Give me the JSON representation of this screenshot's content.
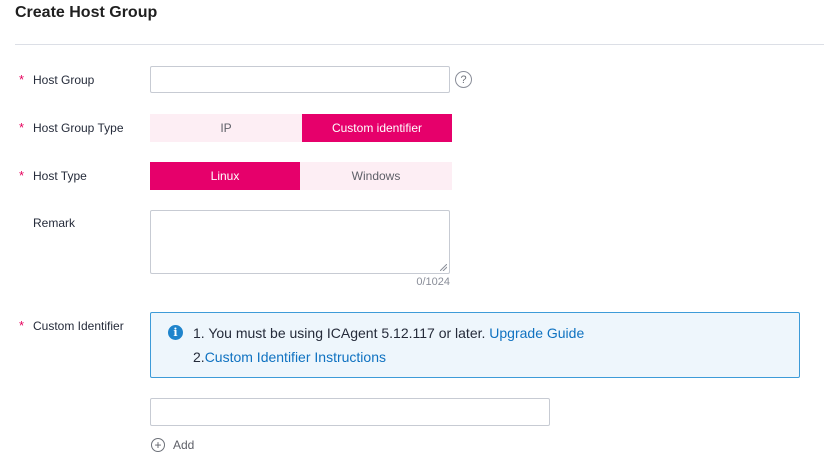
{
  "page": {
    "title": "Create Host Group"
  },
  "form": {
    "host_group": {
      "label": "Host Group",
      "value": "",
      "help_glyph": "?"
    },
    "host_group_type": {
      "label": "Host Group Type",
      "options": [
        "IP",
        "Custom identifier"
      ],
      "selected": "Custom identifier"
    },
    "host_type": {
      "label": "Host Type",
      "options": [
        "Linux",
        "Windows"
      ],
      "selected": "Linux"
    },
    "remark": {
      "label": "Remark",
      "value": "",
      "counter": "0/1024"
    },
    "custom_identifier": {
      "label": "Custom Identifier",
      "info": {
        "line1_text": "1. You must be using ICAgent 5.12.117 or later.",
        "line1_link": "Upgrade Guide",
        "line2_prefix": "2.",
        "line2_link": "Custom Identifier Instructions"
      },
      "value": "",
      "add_label": "Add"
    },
    "required_marker": "*"
  },
  "colors": {
    "accent": "#e6006b",
    "accent_light": "#fdeef4",
    "link": "#0f72c1",
    "info_border": "#3d9bd8",
    "info_bg": "#eef6fc"
  }
}
